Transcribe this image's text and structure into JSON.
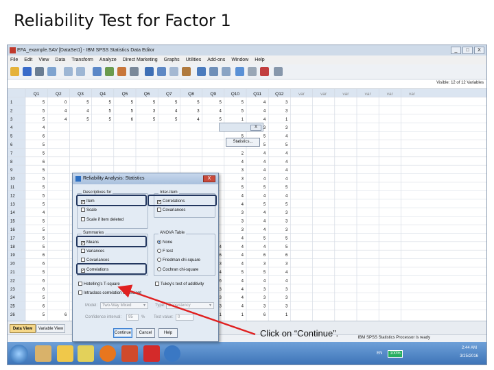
{
  "slide": {
    "title": "Reliability Test for Factor 1",
    "callout": "Click on “Continue”."
  },
  "window": {
    "title": "EFA_example.SAV [DataSet1] - IBM SPSS Statistics Data Editor",
    "minimize": "_",
    "maximize": "□",
    "close": "X"
  },
  "menu": [
    "File",
    "Edit",
    "View",
    "Data",
    "Transform",
    "Analyze",
    "Direct Marketing",
    "Graphs",
    "Utilities",
    "Add-ons",
    "Window",
    "Help"
  ],
  "info": {
    "visible": "Visible: 12 of 12 Variables"
  },
  "grid": {
    "columns": [
      "Q1",
      "Q2",
      "Q3",
      "Q4",
      "Q5",
      "Q6",
      "Q7",
      "Q8",
      "Q9",
      "Q10",
      "Q11",
      "Q12",
      "var",
      "var",
      "var",
      "var",
      "var",
      "var"
    ],
    "row_numbers": [
      "1",
      "2",
      "3",
      "4",
      "5",
      "6",
      "7",
      "8",
      "9",
      "10",
      "11",
      "12",
      "13",
      "14",
      "15",
      "16",
      "17",
      "18",
      "19",
      "20",
      "21",
      "22",
      "23",
      "24",
      "25",
      "26"
    ],
    "rows": [
      [
        "5",
        "0",
        "5",
        "5",
        "5",
        "5",
        "5",
        "5",
        "5",
        "5",
        "4",
        "3"
      ],
      [
        "5",
        "4",
        "4",
        "5",
        "5",
        "3",
        "4",
        "3",
        "4",
        "5",
        "4",
        "3"
      ],
      [
        "5",
        "4",
        "5",
        "5",
        "6",
        "5",
        "5",
        "4",
        "5",
        "1",
        "4",
        "1"
      ],
      [
        "4",
        "",
        "",
        "",
        "",
        "",
        "",
        "",
        "",
        "4",
        "3",
        "3"
      ],
      [
        "6",
        "",
        "",
        "",
        "",
        "",
        "",
        "",
        "",
        "5",
        "5",
        "4"
      ],
      [
        "5",
        "",
        "",
        "",
        "",
        "",
        "",
        "",
        "",
        "1",
        "5",
        "5"
      ],
      [
        "5",
        "",
        "",
        "",
        "",
        "",
        "",
        "",
        "",
        "2",
        "4",
        "4"
      ],
      [
        "6",
        "",
        "",
        "",
        "",
        "",
        "",
        "",
        "",
        "4",
        "4",
        "4"
      ],
      [
        "5",
        "",
        "",
        "",
        "",
        "",
        "",
        "",
        "",
        "3",
        "4",
        "4"
      ],
      [
        "5",
        "",
        "",
        "",
        "",
        "",
        "",
        "",
        "",
        "3",
        "4",
        "4"
      ],
      [
        "5",
        "",
        "",
        "",
        "",
        "",
        "",
        "",
        "",
        "5",
        "5",
        "5"
      ],
      [
        "5",
        "",
        "",
        "",
        "",
        "",
        "",
        "",
        "",
        "4",
        "4",
        "4"
      ],
      [
        "5",
        "",
        "",
        "",
        "",
        "",
        "",
        "",
        "",
        "4",
        "5",
        "5"
      ],
      [
        "4",
        "",
        "",
        "",
        "",
        "",
        "",
        "",
        "",
        "3",
        "4",
        "3"
      ],
      [
        "5",
        "",
        "",
        "",
        "",
        "",
        "",
        "",
        "",
        "3",
        "4",
        "3"
      ],
      [
        "5",
        "",
        "",
        "",
        "",
        "",
        "",
        "",
        "",
        "3",
        "4",
        "3"
      ],
      [
        "5",
        "",
        "",
        "",
        "",
        "",
        "",
        "",
        "",
        "4",
        "5",
        "5"
      ],
      [
        "5",
        "",
        "",
        "",
        "",
        "",
        "",
        "5",
        "4",
        "4",
        "4",
        "5"
      ],
      [
        "6",
        "",
        "",
        "",
        "",
        "",
        "",
        "6",
        "6",
        "4",
        "6",
        "6"
      ],
      [
        "6",
        "",
        "",
        "",
        "",
        "",
        "",
        "3",
        "3",
        "4",
        "3",
        "3"
      ],
      [
        "5",
        "",
        "",
        "",
        "",
        "",
        "",
        "3",
        "4",
        "5",
        "5",
        "4"
      ],
      [
        "6",
        "",
        "",
        "",
        "",
        "",
        "",
        "3",
        "6",
        "4",
        "4",
        "4"
      ],
      [
        "6",
        "",
        "",
        "",
        "",
        "",
        "",
        "3",
        "3",
        "4",
        "3",
        "3"
      ],
      [
        "5",
        "",
        "",
        "",
        "",
        "",
        "",
        "3",
        "3",
        "4",
        "3",
        "3"
      ],
      [
        "6",
        "",
        "",
        "",
        "",
        "",
        "",
        "3",
        "3",
        "4",
        "3",
        "3"
      ],
      [
        "5",
        "6",
        "6",
        "5",
        "6",
        "5",
        "6",
        "4",
        "1",
        "1",
        "6",
        "1"
      ]
    ]
  },
  "reliability_dialog": {
    "statistics_button": "Statistics..."
  },
  "dialog": {
    "title": "Reliability Analysis: Statistics",
    "close": "X",
    "descriptives_group": "Descriptives for",
    "descriptives": [
      {
        "label": "Item",
        "checked": true
      },
      {
        "label": "Scale",
        "checked": false
      },
      {
        "label": "Scale if item deleted",
        "checked": false
      }
    ],
    "inter_item_group": "Inter-Item",
    "inter_item": [
      {
        "label": "Correlations",
        "checked": true
      },
      {
        "label": "Covariances",
        "checked": false
      }
    ],
    "summaries_group": "Summaries",
    "summaries": [
      {
        "label": "Means",
        "checked": true
      },
      {
        "label": "Variances",
        "checked": false
      },
      {
        "label": "Covariances",
        "checked": false
      },
      {
        "label": "Correlations",
        "checked": true
      }
    ],
    "anova_group": "ANOVA Table",
    "anova": [
      {
        "label": "None",
        "selected": true
      },
      {
        "label": "F test",
        "selected": false
      },
      {
        "label": "Friedman chi-square",
        "selected": false
      },
      {
        "label": "Cochran chi-square",
        "selected": false
      }
    ],
    "hotelling": "Hotelling's T-square",
    "tukey": "Tukey's test of additivity",
    "icc": "Intraclass correlation coefficient",
    "model_label": "Model:",
    "model_value": "Two-Way Mixed",
    "type_label": "Type:",
    "type_value": "Consistency",
    "confidence_label": "Confidence interval:",
    "confidence_value": "95",
    "confidence_unit": "%",
    "test_value_label": "Test value:",
    "test_value": "0",
    "buttons": {
      "continue": "Continue",
      "cancel": "Cancel",
      "help": "Help"
    }
  },
  "tabs": {
    "data_view": "Data View",
    "variable_view": "Variable View"
  },
  "status": {
    "text": "IBM SPSS Statistics Processor is ready"
  },
  "taskbar": {
    "lang": "EN",
    "battery": "100%",
    "time": "2:44 AM",
    "date": "3/25/2016"
  },
  "colors": {
    "highlight": "#23375f",
    "arrow": "#e02020",
    "grid_header": "#dbe5f1"
  }
}
